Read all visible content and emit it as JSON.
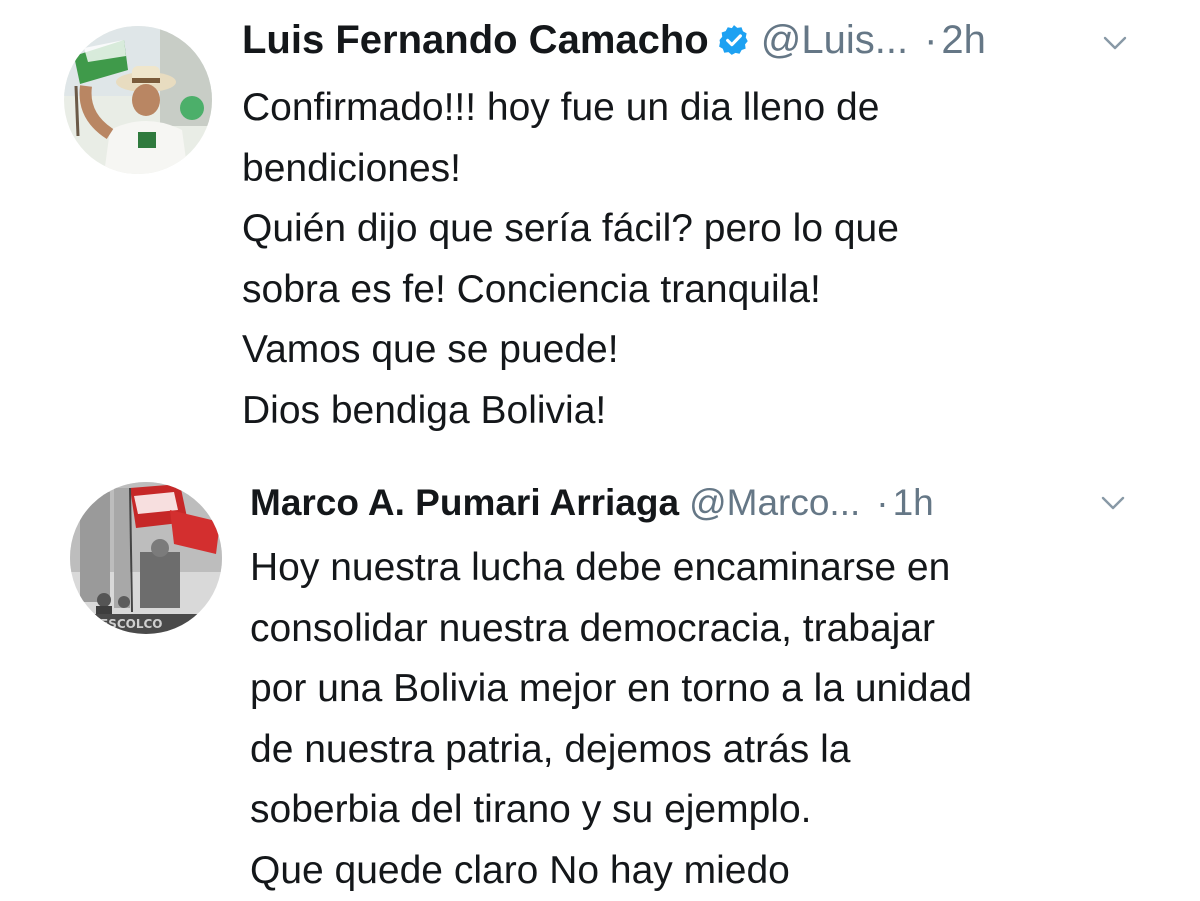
{
  "tweets": [
    {
      "display_name": "Luis Fernando Camacho",
      "verified": true,
      "handle": "@Luis...",
      "separator": "·",
      "time": "2h",
      "lines": [
        "Confirmado!!! hoy fue un dia lleno de",
        "bendiciones!",
        "Quién dijo que sería fácil? pero lo que",
        "sobra es fe! Conciencia tranquila!",
        "Vamos que se puede!",
        "Dios bendiga Bolivia!"
      ]
    },
    {
      "display_name": "Marco A. Pumari Arriaga",
      "verified": false,
      "handle": "@Marco...",
      "separator": "·",
      "time": "1h",
      "lines": [
        "Hoy nuestra lucha debe encaminarse en",
        "consolidar nuestra democracia, trabajar",
        "por una Bolivia mejor en torno a la unidad",
        "de nuestra patria, dejemos atrás la",
        "soberbia del tirano y su ejemplo.",
        "Que quede claro No hay miedo"
      ]
    }
  ],
  "colors": {
    "text_primary": "#14171a",
    "text_secondary": "#657786",
    "verified_blue": "#1da1f2",
    "background": "#ffffff"
  },
  "icons": {
    "verified": "verified-badge-icon",
    "menu": "chevron-down-icon"
  }
}
